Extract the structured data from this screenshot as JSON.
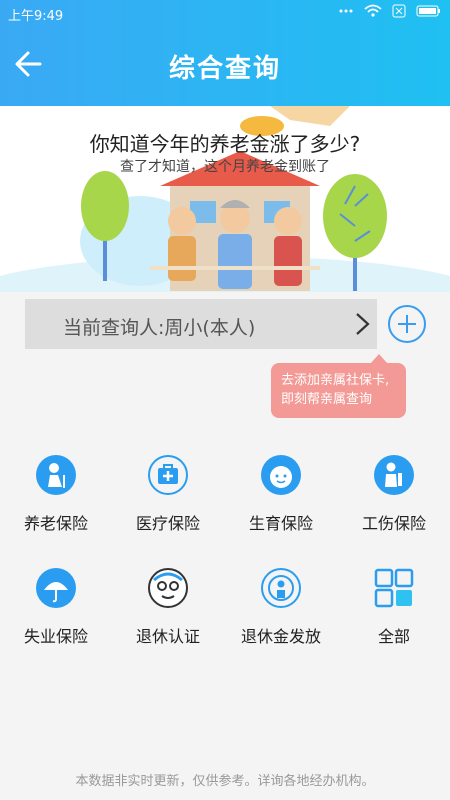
{
  "status": {
    "time": "上午9:49",
    "battery_icon": "battery-icon",
    "wifi_icon": "wifi-icon"
  },
  "nav": {
    "title": "综合查询",
    "back_icon": "back-arrow-icon"
  },
  "banner": {
    "title": "你知道今年的养老金涨了多少?",
    "subtitle": "查了才知道，这个月养老金到账了"
  },
  "query": {
    "label": "当前查询人:周小(本人)"
  },
  "tooltip": {
    "line1": "去添加亲属社保卡,",
    "line2": "即刻帮亲属查询"
  },
  "grid": [
    {
      "label": "养老保险",
      "icon": "elderly-person-icon"
    },
    {
      "label": "医疗保险",
      "icon": "medical-kit-icon"
    },
    {
      "label": "生育保险",
      "icon": "baby-face-icon"
    },
    {
      "label": "工伤保险",
      "icon": "injured-worker-icon"
    },
    {
      "label": "失业保险",
      "icon": "umbrella-icon"
    },
    {
      "label": "退休认证",
      "icon": "retiree-face-icon"
    },
    {
      "label": "退休金发放",
      "icon": "pension-payout-icon"
    },
    {
      "label": "全部",
      "icon": "grid-all-icon"
    }
  ],
  "footer": {
    "text": "本数据非实时更新，仅供参考。详询各地经办机构。"
  },
  "colors": {
    "header": "#2fb4f3",
    "icon_blue": "#2a9df0",
    "tooltip": "#f39a96"
  }
}
